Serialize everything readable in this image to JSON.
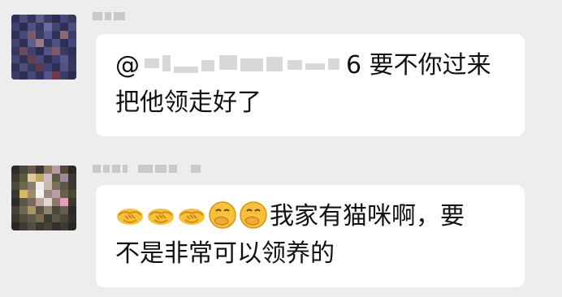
{
  "messages": [
    {
      "line1_prefix": "@",
      "line1_mention_suffix": "6",
      "line1_text": "要不你过来",
      "line2_text": "把他领走好了"
    },
    {
      "emojis": [
        "handshake-emoji",
        "handshake-emoji",
        "handshake-emoji",
        "hand-over-mouth-emoji",
        "hand-over-mouth-emoji"
      ],
      "line1_text": "我家有猫咪啊，要",
      "line2_text": "不是非常可以领养的"
    }
  ],
  "colors": {
    "background": "#ededed",
    "bubble": "#ffffff",
    "text": "#111111",
    "emoji_yellow": "#f6c23a"
  }
}
